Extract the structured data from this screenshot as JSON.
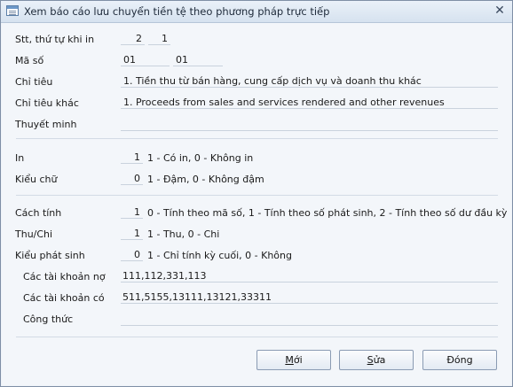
{
  "window": {
    "title": "Xem báo cáo lưu chuyển tiền tệ theo phương pháp trực tiếp"
  },
  "form": {
    "stt": {
      "label": "Stt, thứ tự khi in",
      "value1": "2",
      "value2": "1"
    },
    "ma_so": {
      "label": "Mã số",
      "value1": "01",
      "value2": "01"
    },
    "chi_tieu": {
      "label": "Chỉ tiêu",
      "value": "1. Tiền thu từ bán hàng, cung cấp dịch vụ và doanh thu khác"
    },
    "chi_tieu_khac": {
      "label": "Chỉ tiêu khác",
      "value": "1. Proceeds from sales and services rendered and other revenues"
    },
    "thuyet_minh": {
      "label": "Thuyết minh",
      "value": ""
    },
    "in": {
      "label": "In",
      "value": "1",
      "hint": "1 - Có in, 0 - Không in"
    },
    "kieu_chu": {
      "label": "Kiểu chữ",
      "value": "0",
      "hint": "1 - Đậm, 0 - Không đậm"
    },
    "cach_tinh": {
      "label": "Cách tính",
      "value": "1",
      "hint": "0 - Tính theo mã số, 1 - Tính theo số phát sinh, 2 - Tính theo số dư đầu kỳ"
    },
    "thu_chi": {
      "label": "Thu/Chi",
      "value": "1",
      "hint": "1 - Thu, 0 - Chi"
    },
    "kieu_phat_sinh": {
      "label": "Kiểu phát sinh",
      "value": "0",
      "hint": "1 - Chỉ tính kỳ cuối, 0 - Không"
    },
    "tk_no": {
      "label": "Các tài khoản nợ",
      "value": "111,112,331,113"
    },
    "tk_co": {
      "label": "Các tài khoản có",
      "value": "511,5155,13111,13121,33311"
    },
    "cong_thuc": {
      "label": "Công thức",
      "value": ""
    }
  },
  "buttons": {
    "moi": {
      "accel": "M",
      "rest": "ới"
    },
    "sua": {
      "accel": "S",
      "rest": "ửa"
    },
    "dong": {
      "label": "Đóng"
    }
  }
}
